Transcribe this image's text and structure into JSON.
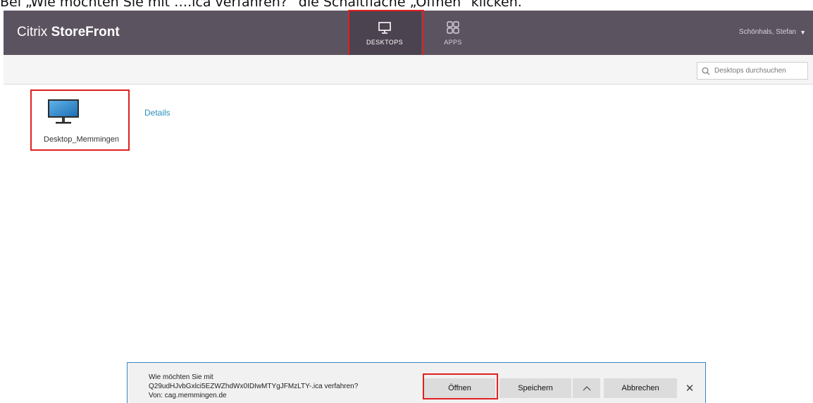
{
  "caption": "Bei „Wie möchten Sie mit ….ica verfahren?“ die Schaltfläche „Öffnen“ klicken.",
  "header": {
    "brand_prefix": "Citrix ",
    "brand_name": "StoreFront",
    "tabs": [
      {
        "label": "DESKTOPS",
        "icon": "monitor-icon",
        "active": true
      },
      {
        "label": "APPS",
        "icon": "apps-grid-icon",
        "active": false
      }
    ],
    "user": "Schönhals, Stefan",
    "user_caret": "▼"
  },
  "subbar": {
    "search_placeholder": "Desktops durchsuchen",
    "search_icon": "search-icon"
  },
  "desktops": [
    {
      "name": "Desktop_Memmingen",
      "icon": "monitor-icon",
      "details_label": "Details"
    }
  ],
  "download_bar": {
    "line1": "Wie möchten Sie mit",
    "line2": "Q29udHJvbGxlci5EZWZhdWx0IDIwMTYgJFMzLTY-.ica verfahren?",
    "line3": "Von: cag.memmingen.de",
    "open_label": "Öffnen",
    "save_label": "Speichern",
    "cancel_label": "Abbrechen",
    "close_label": "✕"
  },
  "colors": {
    "header_bg": "#5c5360",
    "header_active_tab": "#4b434f",
    "highlight": "#e02020",
    "link": "#2a8fbd",
    "download_bar_border": "#3b86c4"
  }
}
